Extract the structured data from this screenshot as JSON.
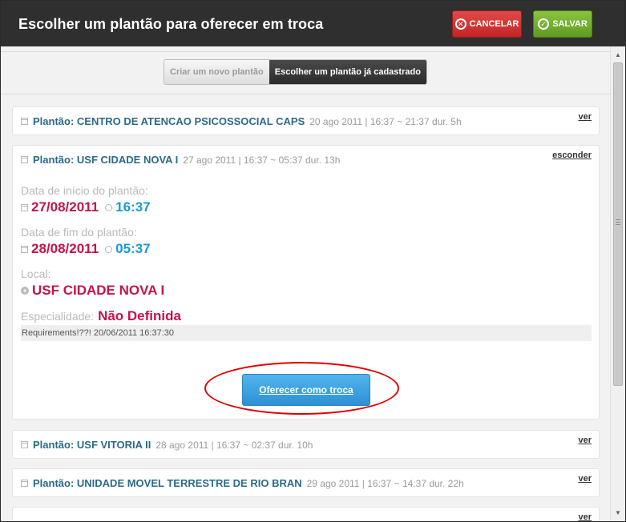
{
  "header": {
    "title": "Escolher um plantão para oferecer em troca",
    "cancel_label": "CANCELAR",
    "save_label": "SALVAR"
  },
  "tabs": [
    {
      "label": "Criar um novo plantão",
      "active": false
    },
    {
      "label": "Escolher um plantão já cadastrado",
      "active": true
    }
  ],
  "cards": [
    {
      "title": "Plantão: CENTRO DE ATENCAO PSICOSSOCIAL CAPS",
      "meta": "20 ago 2011 | 16:37 ~ 21:37 dur. 5h",
      "link": "ver"
    },
    {
      "title": "Plantão: USF CIDADE NOVA I",
      "meta": "27 ago 2011 | 16:37 ~ 05:37 dur. 13h",
      "link": "esconder",
      "expanded": {
        "start_label": "Data de início do plantão:",
        "start_date": "27/08/2011",
        "start_time": "16:37",
        "end_label": "Data de fim do plantão:",
        "end_date": "28/08/2011",
        "end_time": "05:37",
        "local_label": "Local:",
        "local_value": "USF CIDADE NOVA I",
        "spec_label": "Especialidade:",
        "spec_value": "Não Definida",
        "requirements": "Requirements!??! 20/06/2011 16:37:30",
        "offer_button": "Oferecer como troca"
      }
    },
    {
      "title": "Plantão: USF VITORIA II",
      "meta": "28 ago 2011 | 16:37 ~ 02:37 dur. 10h",
      "link": "ver"
    },
    {
      "title": "Plantão: UNIDADE MOVEL TERRESTRE DE RIO BRAN",
      "meta": "29 ago 2011 | 16:37 ~ 14:37 dur. 22h",
      "link": "ver"
    },
    {
      "title": "",
      "meta": "",
      "link": "ver"
    }
  ],
  "colors": {
    "header_bg": "#2f2f2f",
    "cancel": "#d33333",
    "save": "#76b232",
    "title_blue": "#2b6a88",
    "date_red": "#c4134a",
    "time_blue": "#1a9bd1",
    "highlight": "#e00000"
  },
  "icons": {
    "cancel": "x-circle-icon",
    "save": "check-circle-icon",
    "date": "calendar-icon",
    "time": "clock-icon",
    "local": "plus-circle-icon"
  }
}
